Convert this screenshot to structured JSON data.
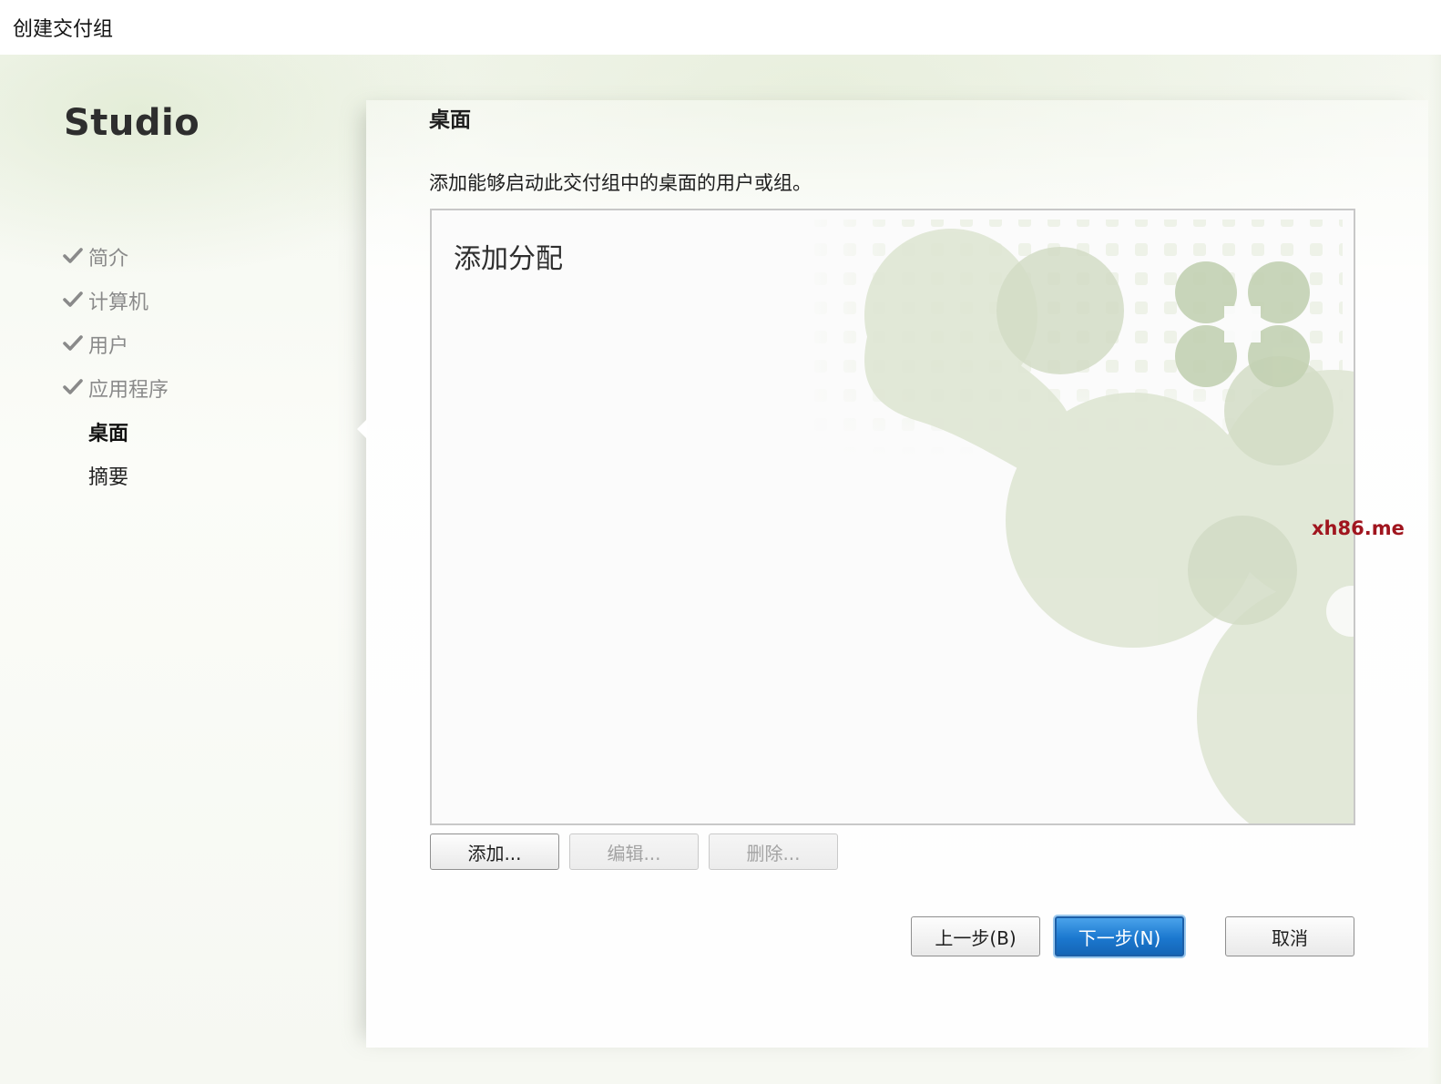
{
  "window": {
    "title": "创建交付组"
  },
  "sidebar": {
    "brand": "Studio",
    "steps": [
      {
        "label": "简介",
        "state": "done"
      },
      {
        "label": "计算机",
        "state": "done"
      },
      {
        "label": "用户",
        "state": "done"
      },
      {
        "label": "应用程序",
        "state": "done"
      },
      {
        "label": "桌面",
        "state": "current"
      },
      {
        "label": "摘要",
        "state": "pending"
      }
    ]
  },
  "main": {
    "title": "桌面",
    "description": "添加能够启动此交付组中的桌面的用户或组。",
    "list": {
      "empty_title": "添加分配"
    },
    "list_buttons": {
      "add": "添加...",
      "edit": "编辑...",
      "delete": "删除..."
    }
  },
  "footer": {
    "back": "上一步(B)",
    "next": "下一步(N)",
    "cancel": "取消"
  },
  "watermark_text": "xh86.me",
  "colors": {
    "primary_button": "#1b78cf",
    "check_mark": "#8a8a8a",
    "watermark_text": "#a0151e"
  }
}
